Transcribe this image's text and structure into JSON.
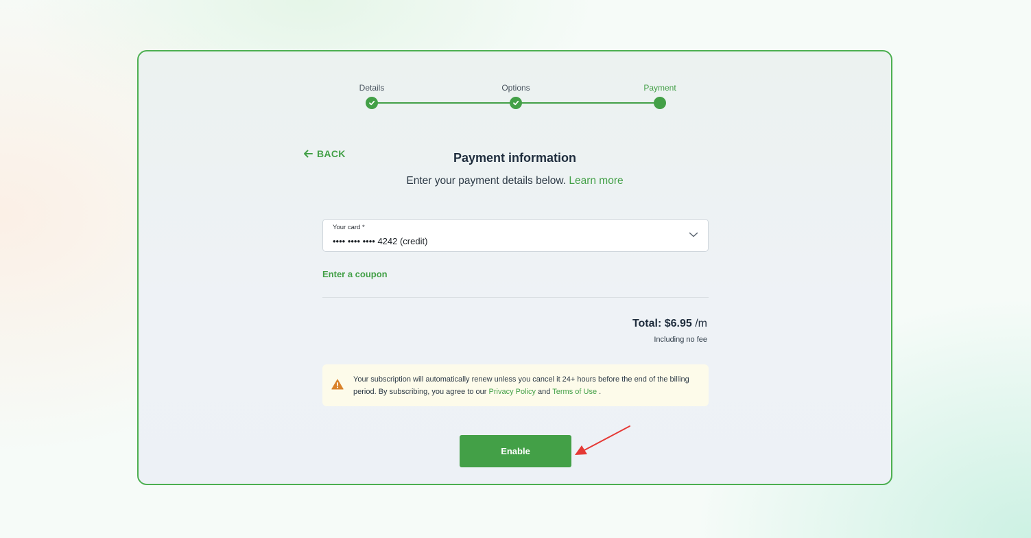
{
  "stepper": {
    "back_label": "BACK",
    "steps": [
      {
        "label": "Details",
        "status": "complete"
      },
      {
        "label": "Options",
        "status": "complete"
      },
      {
        "label": "Payment",
        "status": "current"
      }
    ]
  },
  "header": {
    "title": "Payment information",
    "subtitle": "Enter your payment details below.",
    "learn_more": "Learn more"
  },
  "card_select": {
    "label": "Your card *",
    "value": "•••• •••• •••• 4242 (credit)"
  },
  "coupon_link": "Enter a coupon",
  "summary": {
    "total_label": "Total: $6.95",
    "period": " /m",
    "fee_note": "Including no fee"
  },
  "notice": {
    "text_before": "Your subscription will automatically renew unless you cancel it 24+ hours before the end of the billing period. By subscribing, you agree to our ",
    "privacy_link": "Privacy Policy",
    "and": " and ",
    "terms_link": "Terms of Use",
    "text_after": " ."
  },
  "enable_button": "Enable",
  "colors": {
    "accent": "#43a047",
    "warning": "#d9822b",
    "annotation": "#e53935"
  }
}
